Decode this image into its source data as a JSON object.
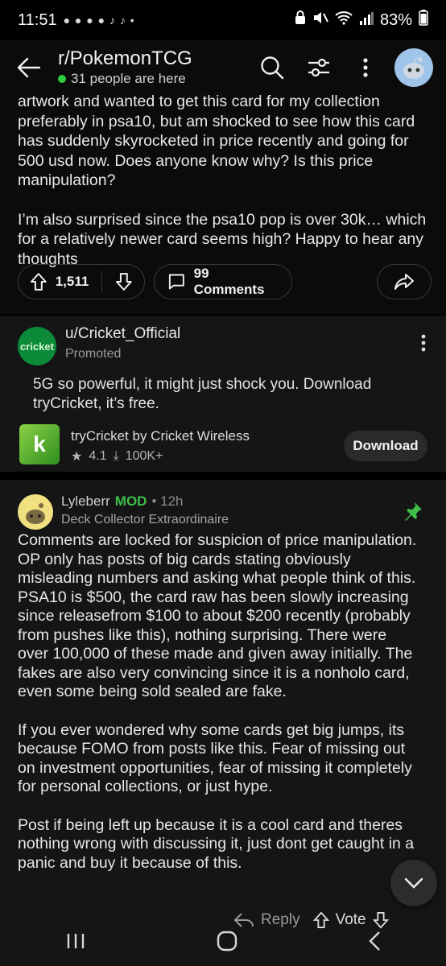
{
  "status": {
    "time": "11:51",
    "notifications": "● ● ● ● ♪ ♪ •",
    "battery": "83%"
  },
  "header": {
    "subreddit": "r/PokemonTCG",
    "online": "31 people are here"
  },
  "post": {
    "paragraph1": "artwork and wanted to get this card for my collection preferably in psa10, but am shocked to see how this card has suddenly skyrocketed in price recently and going for 500 usd now. Does anyone know why? Is this price manipulation?",
    "paragraph2": "I’m also surprised since the psa10 pop is over 30k… which for a relatively newer card seems high? Happy to hear any thoughts",
    "votes": "1,511",
    "comments": "99 Comments"
  },
  "ad": {
    "avatar_text": "cricket",
    "user": "u/Cricket_Official",
    "promoted": "Promoted",
    "text": "5G so powerful, it might just shock you. Download tryCricket, it’s free.",
    "app_name": "tryCricket by Cricket Wireless",
    "rating": "4.1",
    "downloads": "100K+",
    "download_label": "Download",
    "app_icon_letter": "k"
  },
  "comment": {
    "author": "Lyleberr",
    "mod": "MOD",
    "time": "• 12h",
    "flair": "Deck Collector Extraordinaire",
    "p1": "Comments are locked for suspicion of price manipulation. OP only has posts of big cards stating obviously misleading numbers and asking what people think of this. PSA10 is $500, the card raw has been slowly increasing since releasefrom $100 to about $200 recently (probably from pushes like this), nothing surprising. There were over 100,000 of these made and given away initially. The fakes are also very convincing since it is a nonholo card, even some being sold sealed are fake.",
    "p2": "If you ever wondered why some cards get big jumps, its because FOMO from posts like this. Fear of missing out on investment opportunities, fear of missing it completely for personal collections, or just hype.",
    "p3": "Post if being left up because it is a cool card and theres nothing wrong with discussing it, just dont get caught in a panic and buy it because of this.",
    "reply": "Reply",
    "vote": "Vote"
  },
  "colors": {
    "mod_green": "#3fbf4a",
    "online_dot": "#2ecc40",
    "background": "#151515"
  }
}
